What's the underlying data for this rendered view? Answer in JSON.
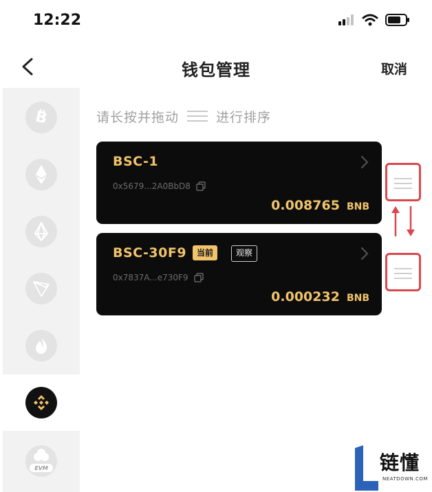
{
  "status_bar": {
    "time": "12:22"
  },
  "header": {
    "title": "钱包管理",
    "cancel_label": "取消"
  },
  "sidebar": {
    "chains": [
      {
        "icon": "bitcoin-icon",
        "active": false
      },
      {
        "icon": "ethereum-icon",
        "active": false
      },
      {
        "icon": "eos-icon",
        "active": false
      },
      {
        "icon": "tron-icon",
        "active": false
      },
      {
        "icon": "heco-icon",
        "active": false
      },
      {
        "icon": "bnb-icon",
        "active": true
      },
      {
        "icon": "evm-icon",
        "active": false,
        "label": "EVM"
      }
    ]
  },
  "hint": {
    "before": "请长按并拖动",
    "after": "进行排序"
  },
  "wallets": [
    {
      "name": "BSC-1",
      "address": "0x5679...2A0BbD8",
      "balance": "0.008765",
      "unit": "BNB"
    },
    {
      "name": "BSC-30F9",
      "badge_current": "当前",
      "badge_watch": "观察",
      "address": "0x7837A...e730F9",
      "balance": "0.000232",
      "unit": "BNB"
    }
  ],
  "colors": {
    "accent_gold": "#f1c46b",
    "card_bg": "#0c0c0c",
    "annotation_red": "#d9474d"
  },
  "watermark": {
    "name": "链懂",
    "domain": "NEATDOWN.COM"
  }
}
